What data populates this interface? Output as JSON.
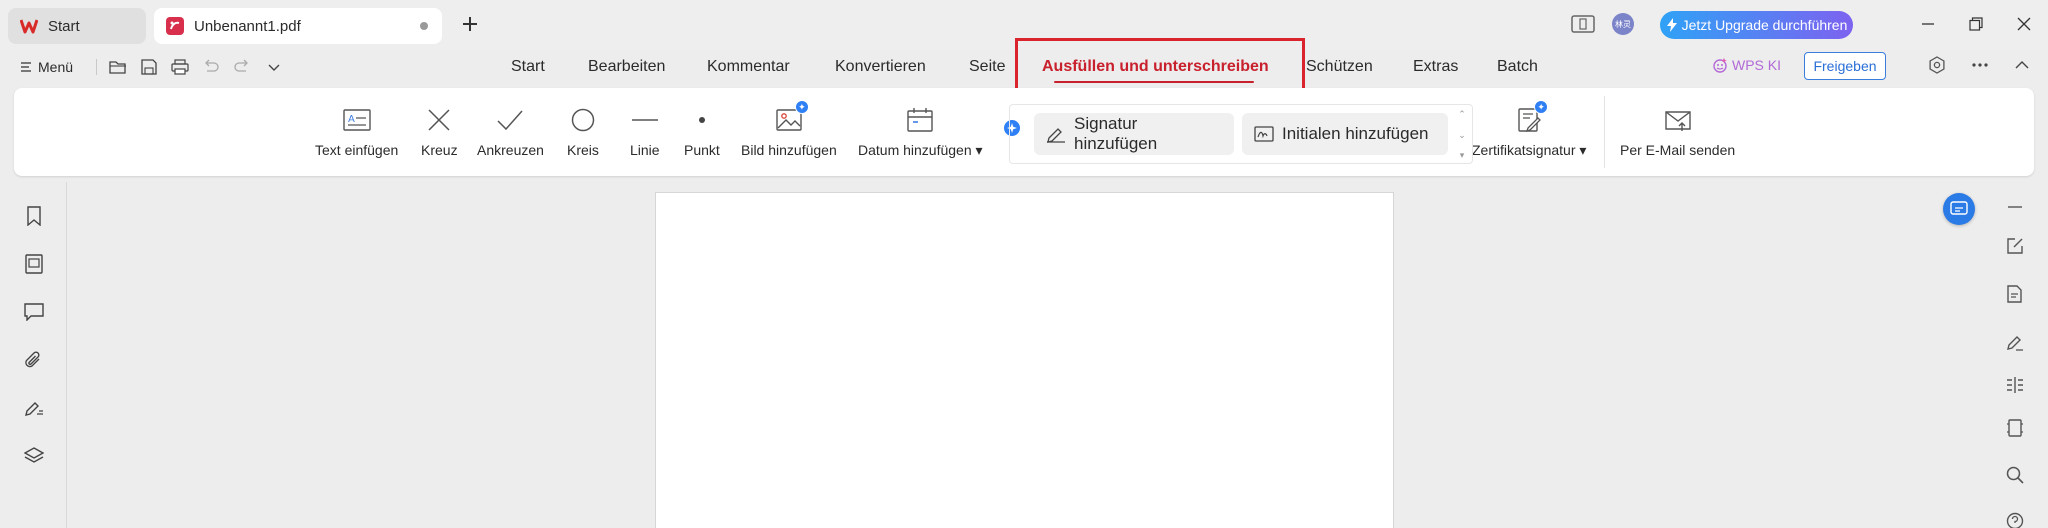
{
  "app": {
    "tabs": [
      {
        "label": "Start",
        "icon": "wps-logo-icon"
      },
      {
        "label": "Unbenannt1.pdf",
        "icon": "pdf-icon"
      }
    ],
    "avatar_text": "林灵",
    "upgrade_label": "Jetzt Upgrade durchführen"
  },
  "menu": {
    "menu_label": "Menü",
    "nav_tabs": [
      "Start",
      "Bearbeiten",
      "Kommentar",
      "Konvertieren",
      "Seite",
      "Ausfüllen und unterschreiben",
      "Schützen",
      "Extras",
      "Batch"
    ],
    "active_tab": "Ausfüllen und unterschreiben",
    "wps_ki": "WPS KI",
    "share_label": "Freigeben"
  },
  "ribbon": {
    "tools": [
      "Text einfügen",
      "Kreuz",
      "Ankreuzen",
      "Kreis",
      "Linie",
      "Punkt",
      "Bild hinzufügen",
      "Datum hinzufügen"
    ],
    "signature_label": "Signatur hinzufügen",
    "initials_label": "Initialen hinzufügen",
    "certificate_label": "Zertifikatsignatur",
    "email_label": "Per E-Mail senden"
  },
  "colors": {
    "accent_red": "#c8202c",
    "highlight_red": "#d9232d",
    "primary_blue": "#2b7be6",
    "upgrade_gradient_start": "#2fa2f6",
    "upgrade_gradient_end": "#7d62f0"
  }
}
